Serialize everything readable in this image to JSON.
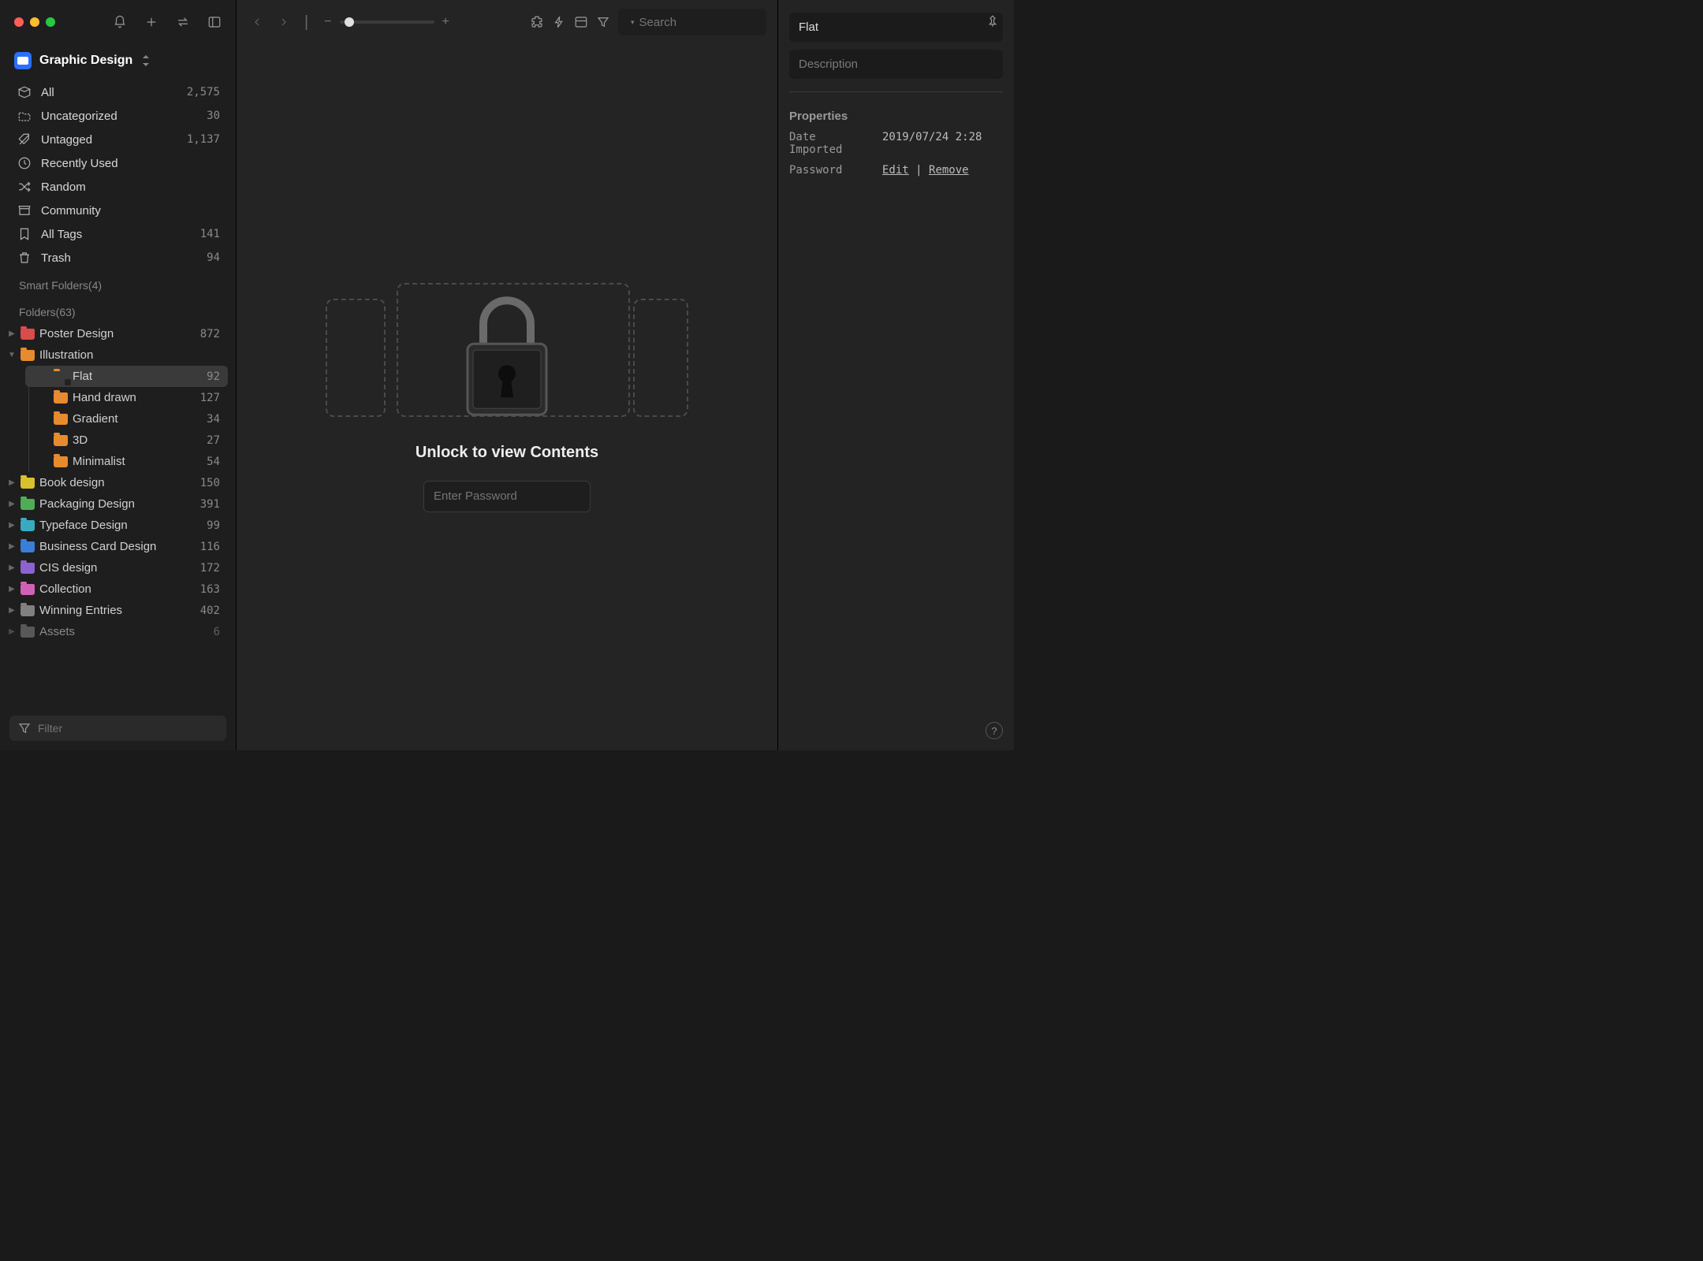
{
  "library": {
    "name": "Graphic Design"
  },
  "smart": {
    "all": {
      "label": "All",
      "count": "2,575"
    },
    "uncat": {
      "label": "Uncategorized",
      "count": "30"
    },
    "untag": {
      "label": "Untagged",
      "count": "1,137"
    },
    "recent": {
      "label": "Recently Used",
      "count": ""
    },
    "random": {
      "label": "Random",
      "count": ""
    },
    "comm": {
      "label": "Community",
      "count": ""
    },
    "tags": {
      "label": "All Tags",
      "count": "141"
    },
    "trash": {
      "label": "Trash",
      "count": "94"
    }
  },
  "sections": {
    "smart": "Smart Folders(4)",
    "folders": "Folders(63)"
  },
  "folders": {
    "poster": {
      "label": "Poster Design",
      "count": "872"
    },
    "illus": {
      "label": "Illustration",
      "count": ""
    },
    "book": {
      "label": "Book design",
      "count": "150"
    },
    "pack": {
      "label": "Packaging Design",
      "count": "391"
    },
    "type": {
      "label": "Typeface Design",
      "count": "99"
    },
    "biz": {
      "label": "Business Card Design",
      "count": "116"
    },
    "cis": {
      "label": "CIS design",
      "count": "172"
    },
    "coll": {
      "label": "Collection",
      "count": "163"
    },
    "win": {
      "label": "Winning Entries",
      "count": "402"
    },
    "assets": {
      "label": "Assets",
      "count": "6"
    }
  },
  "illus_children": {
    "flat": {
      "label": "Flat",
      "count": "92"
    },
    "hand": {
      "label": "Hand drawn",
      "count": "127"
    },
    "grad": {
      "label": "Gradient",
      "count": "34"
    },
    "d3": {
      "label": "3D",
      "count": "27"
    },
    "min": {
      "label": "Minimalist",
      "count": "54"
    }
  },
  "filter": {
    "placeholder": "Filter"
  },
  "toolbar": {
    "search_placeholder": "Search"
  },
  "lock": {
    "title": "Unlock to view Contents",
    "placeholder": "Enter Password"
  },
  "inspector": {
    "title": "Flat",
    "desc_placeholder": "Description",
    "props_label": "Properties",
    "date_key": "Date Imported",
    "date_val": "2019/07/24 2:28",
    "pw_key": "Password",
    "pw_edit": "Edit",
    "pw_sep": " | ",
    "pw_remove": "Remove"
  }
}
